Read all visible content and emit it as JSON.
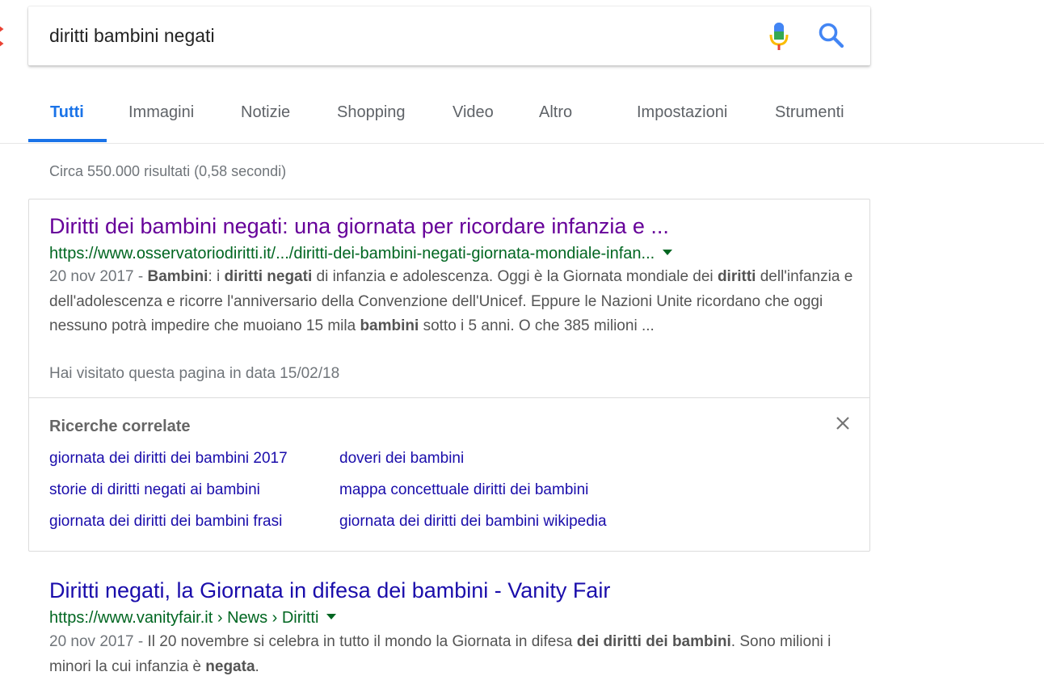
{
  "search": {
    "query": "diritti bambini negati"
  },
  "tabs": [
    {
      "label": "Tutti"
    },
    {
      "label": "Immagini"
    },
    {
      "label": "Notizie"
    },
    {
      "label": "Shopping"
    },
    {
      "label": "Video"
    },
    {
      "label": "Altro"
    },
    {
      "label": "Impostazioni"
    },
    {
      "label": "Strumenti"
    }
  ],
  "stats": "Circa 550.000 risultati (0,58 secondi)",
  "results": [
    {
      "title": "Diritti dei bambini negati: una giornata per ricordare infanzia e ...",
      "url": "https://www.osservatoriodiritti.it/.../diritti-dei-bambini-negati-giornata-mondiale-infan...",
      "date": "20 nov 2017 - ",
      "snippet": [
        {
          "t": "Bambini",
          "b": true
        },
        {
          "t": ": i ",
          "b": false
        },
        {
          "t": "diritti negati",
          "b": true
        },
        {
          "t": " di infanzia e adolescenza. Oggi è la Giornata mondiale dei ",
          "b": false
        },
        {
          "t": "diritti",
          "b": true
        },
        {
          "t": " dell'infanzia e dell'adolescenza e ricorre l'anniversario della Convenzione dell'Unicef. Eppure le Nazioni Unite ricordano che oggi nessuno potrà impedire che muoiano 15 mila ",
          "b": false
        },
        {
          "t": "bambini",
          "b": true
        },
        {
          "t": " sotto i 5 anni. O che 385 milioni ...",
          "b": false
        }
      ],
      "visited": "Hai visitato questa pagina in data 15/02/18"
    },
    {
      "title": "Diritti negati, la Giornata in difesa dei bambini - Vanity Fair",
      "url": "https://www.vanityfair.it › News › Diritti",
      "date": "20 nov 2017 - ",
      "snippet": [
        {
          "t": "Il 20 novembre si celebra in tutto il mondo la Giornata in difesa ",
          "b": false
        },
        {
          "t": "dei diritti dei bambini",
          "b": true
        },
        {
          "t": ". Sono milioni i minori la cui infanzia è ",
          "b": false
        },
        {
          "t": "negata",
          "b": true
        },
        {
          "t": ".",
          "b": false
        }
      ]
    }
  ],
  "related": {
    "title": "Ricerche correlate",
    "links": [
      "giornata dei diritti dei bambini 2017",
      "doveri dei bambini",
      "storie di diritti negati ai bambini",
      "mappa concettuale diritti dei bambini",
      "giornata dei diritti dei bambini frasi",
      "giornata dei diritti dei bambini wikipedia"
    ]
  },
  "colors": {
    "accent": "#1a73e8",
    "link": "#1a0dab",
    "visited_link": "#660099",
    "url_green": "#006621"
  },
  "icons": {
    "mic": "microphone-icon",
    "search": "search-icon",
    "close": "close-icon",
    "caret": "caret-down-icon"
  }
}
